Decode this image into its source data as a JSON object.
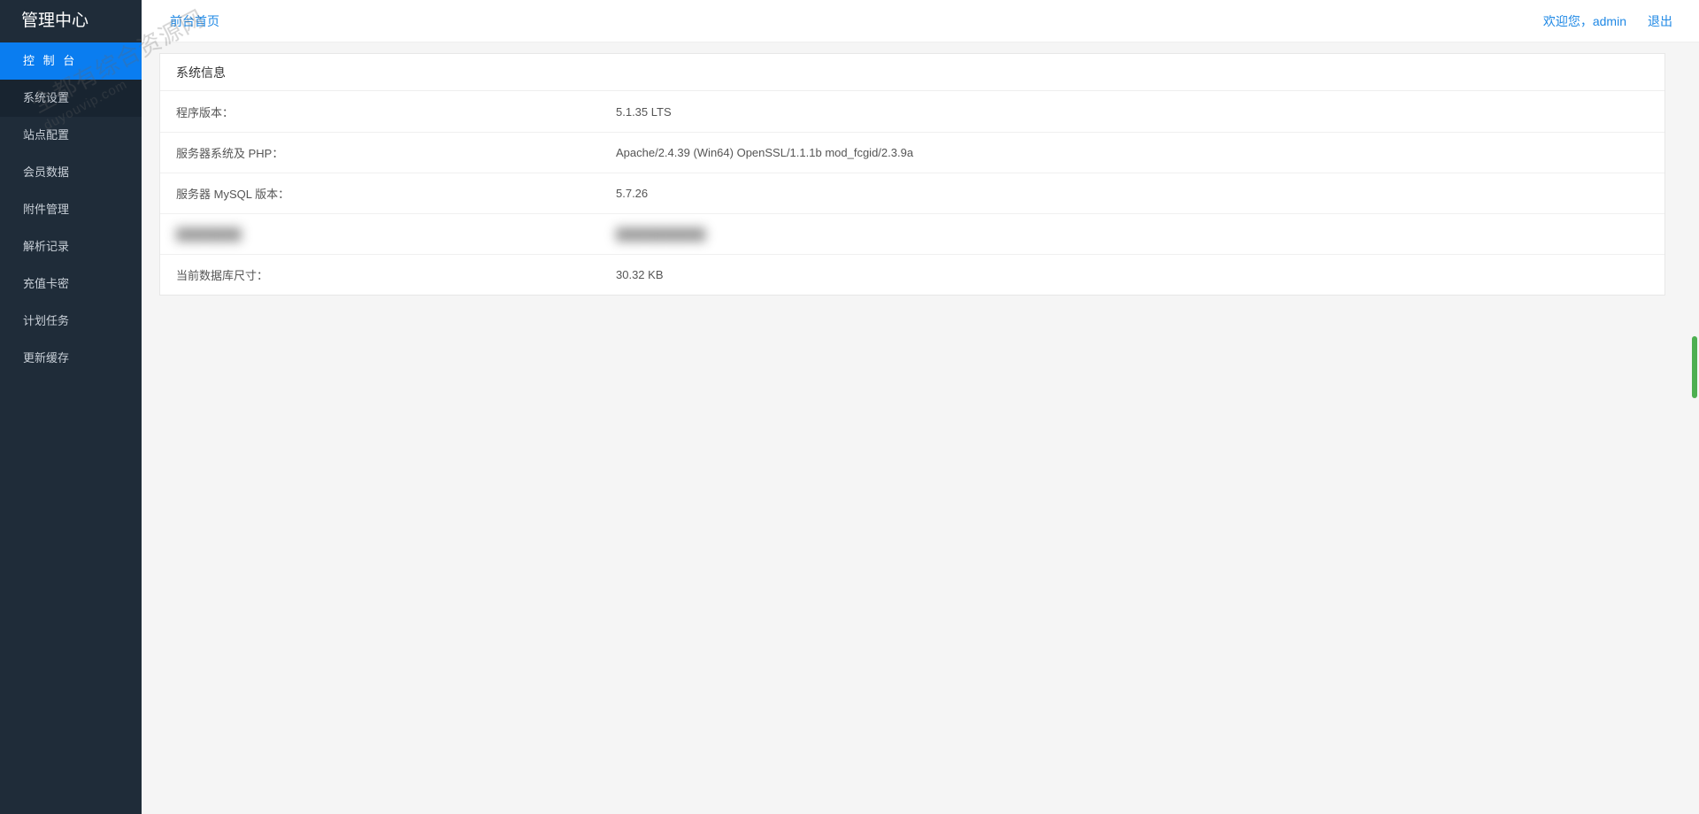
{
  "sidebar": {
    "title": "管理中心",
    "items": [
      {
        "label": "控 制 台",
        "active": true
      },
      {
        "label": "系统设置",
        "darker": true
      },
      {
        "label": "站点配置"
      },
      {
        "label": "会员数据"
      },
      {
        "label": "附件管理"
      },
      {
        "label": "解析记录"
      },
      {
        "label": "充值卡密"
      },
      {
        "label": "计划任务"
      },
      {
        "label": "更新缓存"
      }
    ]
  },
  "topbar": {
    "home_link": "前台首页",
    "welcome": "欢迎您，admin",
    "logout": "退出"
  },
  "panel": {
    "title": "系统信息",
    "rows": [
      {
        "label": "程序版本：",
        "value": "5.1.35 LTS"
      },
      {
        "label": "服务器系统及 PHP：",
        "value": "Apache/2.4.39 (Win64) OpenSSL/1.1.1b mod_fcgid/2.3.9a"
      },
      {
        "label": "服务器 MySQL 版本：",
        "value": "5.7.26"
      },
      {
        "label": "",
        "value": "",
        "blurred": true
      },
      {
        "label": "当前数据库尺寸：",
        "value": "30.32 KB"
      }
    ]
  },
  "watermark": {
    "line1": "全都有综合资源网",
    "line2": "duyouvip.com"
  }
}
